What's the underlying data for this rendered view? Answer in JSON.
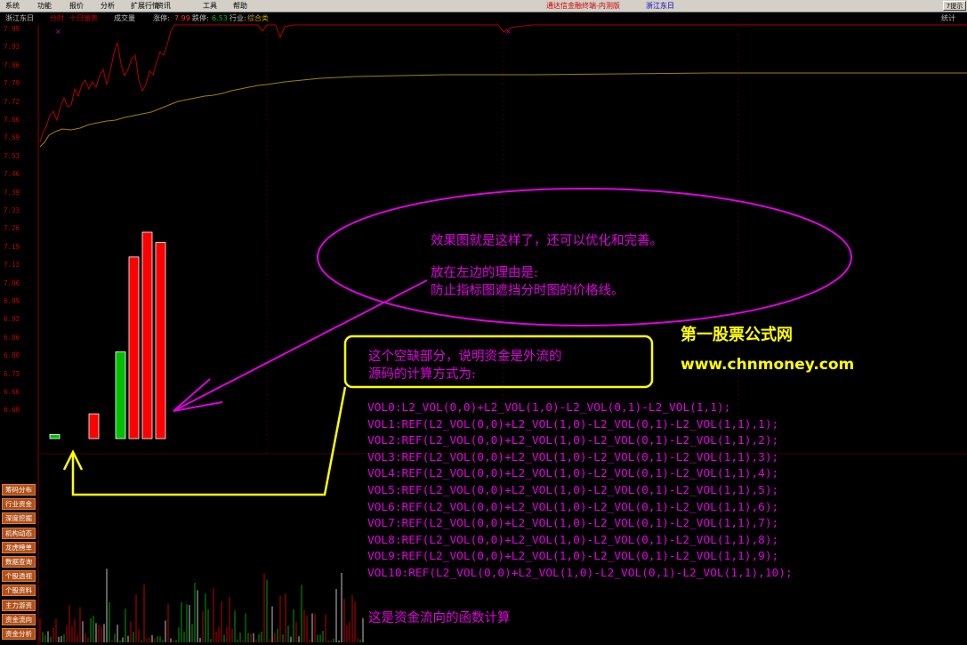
{
  "menu": {
    "items": [
      "系统",
      "功能",
      "报价",
      "分析",
      "扩展行情",
      "资讯",
      "工具",
      "帮助"
    ],
    "app_title": "通达信金融终端-内测版",
    "stock_name": "浙江东日",
    "right_button": "7提示"
  },
  "info": {
    "stock": "浙江东日",
    "mode": "分时",
    "period": "十日量表",
    "vol_label": "成交量",
    "limit_up_label": "涨停:",
    "limit_up": "7.99",
    "limit_down_label": "跌停:",
    "limit_down": "6.53",
    "industry_label": "行业:",
    "industry": "综合类",
    "stat": "统计"
  },
  "price_axis": [
    "7.99",
    "7.93",
    "7.86",
    "7.79",
    "7.72",
    "7.66",
    "7.59",
    "7.53",
    "7.46",
    "7.39",
    "7.33",
    "7.26",
    "7.19",
    "7.13",
    "7.06",
    "6.99",
    "6.93",
    "6.86",
    "6.80",
    "6.73",
    "6.66",
    "6.60"
  ],
  "side_buttons": [
    "筹码分布",
    "行业资金",
    "深度挖掘",
    "机构动态",
    "龙虎榜单",
    "数据查询",
    "个股透视",
    "个股资料",
    "主力游资",
    "资金流向",
    "资金分析"
  ],
  "annotations": {
    "ellipse_line1": "效果图就是这样了，还可以优化和完善。",
    "ellipse_line2": "放在左边的理由是:",
    "ellipse_line3": "防止指标图遮挡分时图的价格线。",
    "box_line1": "这个空缺部分，说明资金是外流的",
    "box_line2": "源码的计算方式为:",
    "footer": "这是资金流向的函数计算",
    "brand_cn": "第一股票公式网",
    "brand_url": "www.chnmoney.com"
  },
  "code_lines": [
    "VOL0:L2_VOL(0,0)+L2_VOL(1,0)-L2_VOL(0,1)-L2_VOL(1,1);",
    "VOL1:REF(L2_VOL(0,0)+L2_VOL(1,0)-L2_VOL(0,1)-L2_VOL(1,1),1);",
    "VOL2:REF(L2_VOL(0,0)+L2_VOL(1,0)-L2_VOL(0,1)-L2_VOL(1,1),2);",
    "VOL3:REF(L2_VOL(0,0)+L2_VOL(1,0)-L2_VOL(0,1)-L2_VOL(1,1),3);",
    "VOL4:REF(L2_VOL(0,0)+L2_VOL(1,0)-L2_VOL(0,1)-L2_VOL(1,1),4);",
    "VOL5:REF(L2_VOL(0,0)+L2_VOL(1,0)-L2_VOL(0,1)-L2_VOL(1,1),5);",
    "VOL6:REF(L2_VOL(0,0)+L2_VOL(1,0)-L2_VOL(0,1)-L2_VOL(1,1),6);",
    "VOL7:REF(L2_VOL(0,0)+L2_VOL(1,0)-L2_VOL(0,1)-L2_VOL(1,1),7);",
    "VOL8:REF(L2_VOL(0,0)+L2_VOL(1,0)-L2_VOL(0,1)-L2_VOL(1,1),8);",
    "VOL9:REF(L2_VOL(0,0)+L2_VOL(1,0)-L2_VOL(0,1)-L2_VOL(1,1),9);",
    "VOL10:REF(L2_VOL(0,0)+L2_VOL(1,0)-L2_VOL(0,1)-L2_VOL(1,1),10);"
  ],
  "indicator_bars": [
    {
      "value": 0.02,
      "color": "#00c000"
    },
    {
      "value": 0.12,
      "color": "#ff0000"
    },
    {
      "value": 0.42,
      "color": "#00c000"
    },
    {
      "value": 0.88,
      "color": "#ff0000"
    },
    {
      "value": 1.0,
      "color": "#ff0000"
    },
    {
      "value": 0.95,
      "color": "#ff0000"
    }
  ],
  "colors": {
    "annotation": "#e000e0",
    "callout": "#ffff00",
    "price_line": "#b00000",
    "avg_line": "#a08000"
  }
}
